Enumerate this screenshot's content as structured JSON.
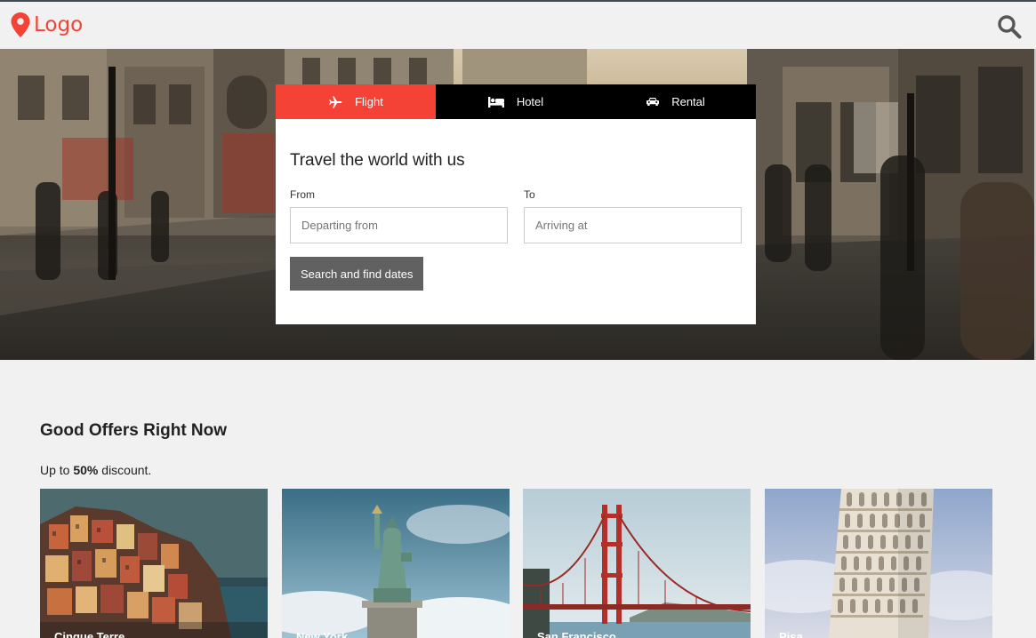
{
  "header": {
    "logo_text": "Logo",
    "logo_icon": "map-marker-icon",
    "search_icon": "search-icon",
    "accent_color": "#f44336"
  },
  "booking": {
    "tabs": [
      {
        "label": "Flight",
        "icon": "plane-icon",
        "active": true
      },
      {
        "label": "Hotel",
        "icon": "bed-icon",
        "active": false
      },
      {
        "label": "Rental",
        "icon": "car-icon",
        "active": false
      }
    ],
    "title": "Travel the world with us",
    "from_label": "From",
    "from_placeholder": "Departing from",
    "to_label": "To",
    "to_placeholder": "Arriving at",
    "submit_label": "Search and find dates"
  },
  "offers": {
    "title": "Good Offers Right Now",
    "subtitle_prefix": "Up to ",
    "subtitle_bold": "50%",
    "subtitle_suffix": " discount.",
    "items": [
      {
        "label": "Cinque Terre",
        "image": "cinque-terre-photo"
      },
      {
        "label": "New York",
        "image": "statue-of-liberty-photo"
      },
      {
        "label": "San Francisco",
        "image": "golden-gate-bridge-photo"
      },
      {
        "label": "Pisa",
        "image": "leaning-tower-of-pisa-photo"
      }
    ]
  }
}
